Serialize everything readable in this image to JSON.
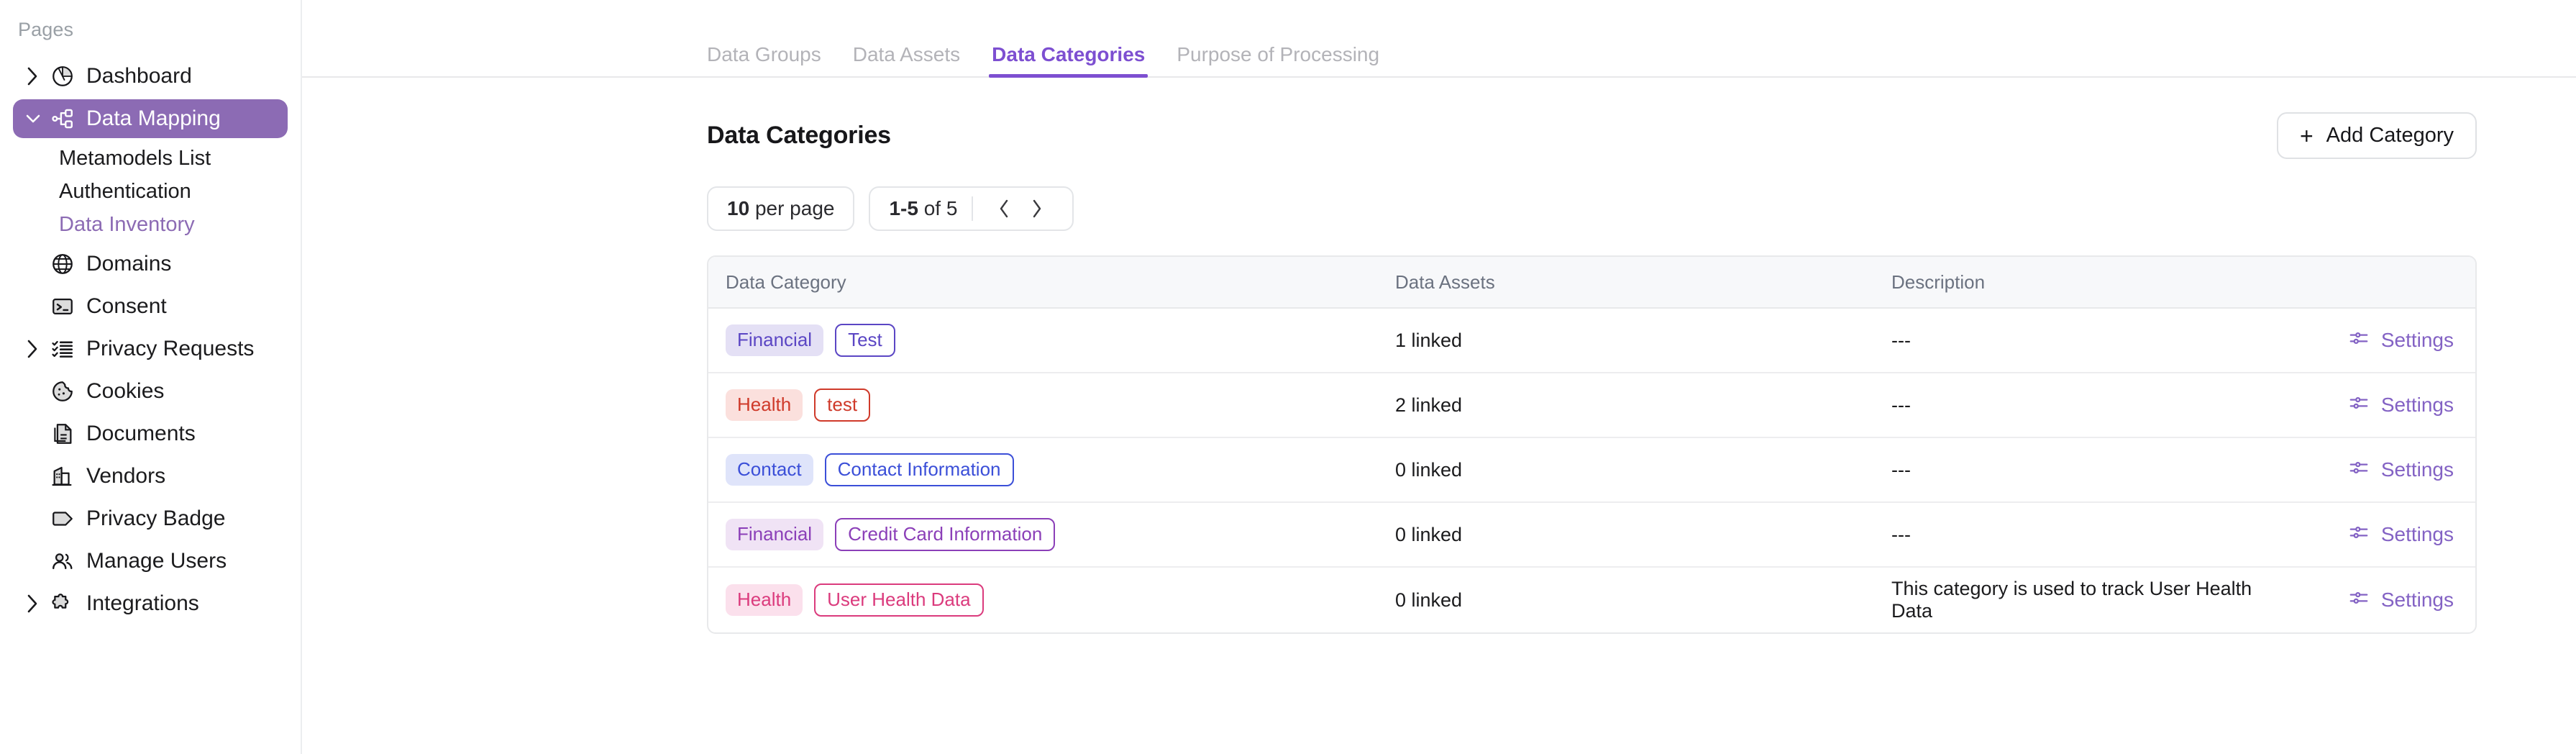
{
  "sidebar": {
    "section_label": "Pages",
    "items": [
      {
        "label": "Dashboard",
        "icon": "pie-chart-icon",
        "caret": true,
        "type": "top"
      },
      {
        "label": "Data Mapping",
        "icon": "sitemap-icon",
        "caret": true,
        "type": "top",
        "active": true,
        "expanded": true
      },
      {
        "label": "Metamodels List",
        "type": "sub"
      },
      {
        "label": "Authentication",
        "type": "sub"
      },
      {
        "label": "Data Inventory",
        "type": "sub",
        "current": true
      },
      {
        "label": "Domains",
        "icon": "globe-icon",
        "caret": false,
        "type": "top"
      },
      {
        "label": "Consent",
        "icon": "terminal-icon",
        "caret": false,
        "type": "top"
      },
      {
        "label": "Privacy Requests",
        "icon": "checklist-icon",
        "caret": true,
        "type": "top"
      },
      {
        "label": "Cookies",
        "icon": "cookie-icon",
        "caret": false,
        "type": "top"
      },
      {
        "label": "Documents",
        "icon": "documents-icon",
        "caret": false,
        "type": "top"
      },
      {
        "label": "Vendors",
        "icon": "building-icon",
        "caret": false,
        "type": "top"
      },
      {
        "label": "Privacy Badge",
        "icon": "tag-icon",
        "caret": false,
        "type": "top"
      },
      {
        "label": "Manage Users",
        "icon": "users-icon",
        "caret": false,
        "type": "top"
      },
      {
        "label": "Integrations",
        "icon": "puzzle-icon",
        "caret": true,
        "type": "top"
      }
    ],
    "accent_color": "#8c6bb4",
    "current_link_color": "#8c6bb4"
  },
  "tabs": [
    {
      "label": "Data Groups",
      "active": false
    },
    {
      "label": "Data Assets",
      "active": false
    },
    {
      "label": "Data Categories",
      "active": true
    },
    {
      "label": "Purpose of Processing",
      "active": false
    }
  ],
  "header": {
    "title": "Data Categories",
    "add_button_label": "Add Category",
    "add_button_icon": "plus-icon"
  },
  "pagination": {
    "per_page_value": "10",
    "per_page_suffix": "per page",
    "range": "1-5",
    "range_suffix": "of 5",
    "prev_icon": "chevron-left-icon",
    "next_icon": "chevron-right-icon"
  },
  "table": {
    "columns": [
      "Data Category",
      "Data Assets",
      "Description"
    ],
    "rows": [
      {
        "group": "Financial",
        "group_bg": "#e4e0f5",
        "group_fg": "#5b46c4",
        "name": "Test",
        "name_fg": "#5b46c4",
        "assets": "1 linked",
        "description": "---",
        "action_label": "Settings",
        "action_icon": "sliders-icon"
      },
      {
        "group": "Health",
        "group_bg": "#fbe0dd",
        "group_fg": "#cf3a2a",
        "name": "test",
        "name_fg": "#cf3a2a",
        "assets": "2 linked",
        "description": "---",
        "action_label": "Settings",
        "action_icon": "sliders-icon"
      },
      {
        "group": "Contact",
        "group_bg": "#dfe4fa",
        "group_fg": "#3b4fd8",
        "name": "Contact Information",
        "name_fg": "#3b4fd8",
        "assets": "0 linked",
        "description": "---",
        "action_label": "Settings",
        "action_icon": "sliders-icon"
      },
      {
        "group": "Financial",
        "group_bg": "#f0e3f5",
        "group_fg": "#8b3fb8",
        "name": "Credit Card Information",
        "name_fg": "#8b3fb8",
        "assets": "0 linked",
        "description": "---",
        "action_label": "Settings",
        "action_icon": "sliders-icon"
      },
      {
        "group": "Health",
        "group_bg": "#fbe0ec",
        "group_fg": "#db3b7d",
        "name": "User Health Data",
        "name_fg": "#db3b7d",
        "assets": "0 linked",
        "description": "This category is used to track User Health Data",
        "action_label": "Settings",
        "action_icon": "sliders-icon"
      }
    ]
  },
  "colors": {
    "tab_active": "#7d4fd1",
    "settings_link": "#8362c4",
    "table_header_bg": "#f7f8fa"
  }
}
